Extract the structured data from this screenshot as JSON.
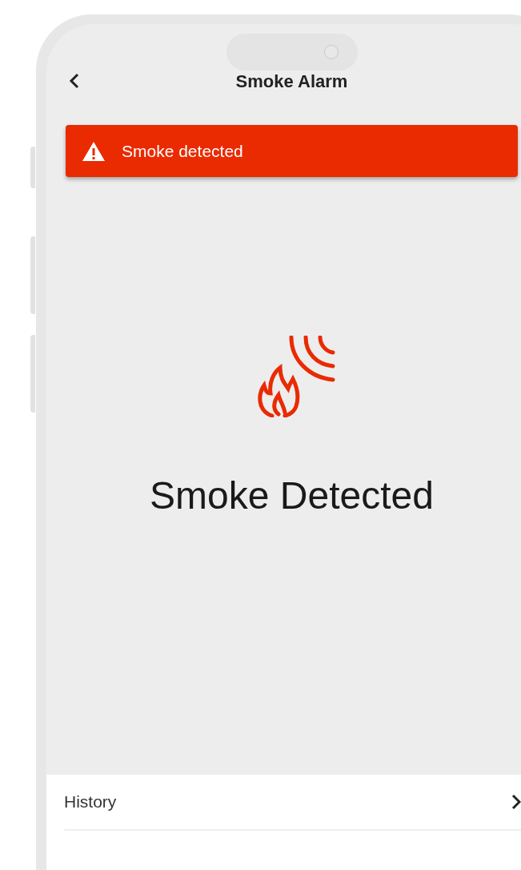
{
  "header": {
    "title": "Smoke Alarm"
  },
  "alert": {
    "text": "Smoke detected"
  },
  "status": {
    "title": "Smoke Detected"
  },
  "menu": [
    {
      "label": "History"
    }
  ]
}
